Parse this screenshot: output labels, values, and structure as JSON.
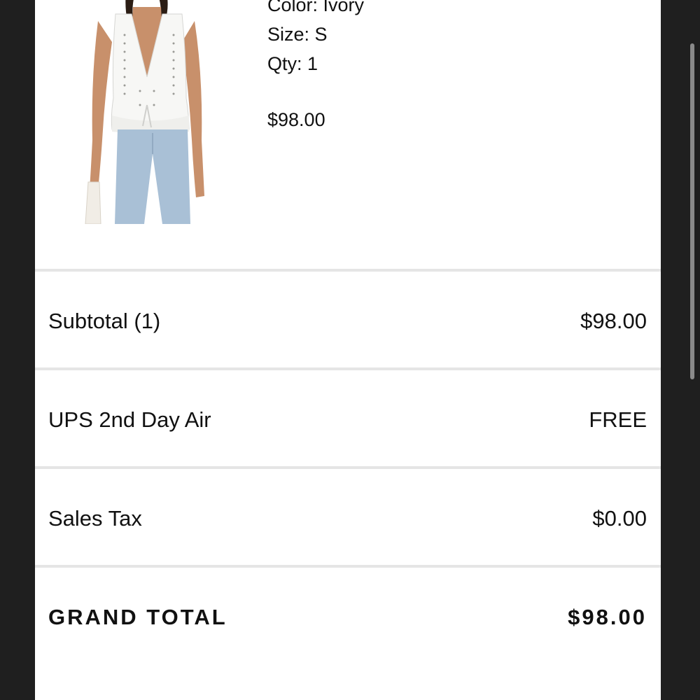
{
  "product": {
    "image_alt": "White eyelet halter top with light wash jeans",
    "color": "Color: Ivory",
    "size": "Size: S",
    "qty": "Qty: 1",
    "price": "$98.00"
  },
  "summary": {
    "subtotal_label": "Subtotal (1)",
    "subtotal_value": "$98.00",
    "shipping_label": "UPS 2nd Day Air",
    "shipping_value": "FREE",
    "tax_label": "Sales Tax",
    "tax_value": "$0.00",
    "grand_total_label": "GRAND TOTAL",
    "grand_total_value": "$98.00"
  },
  "colors": {
    "background": "#1f1f1f",
    "sheet": "#ffffff",
    "divider": "#e5e5e5",
    "text": "#111111"
  }
}
